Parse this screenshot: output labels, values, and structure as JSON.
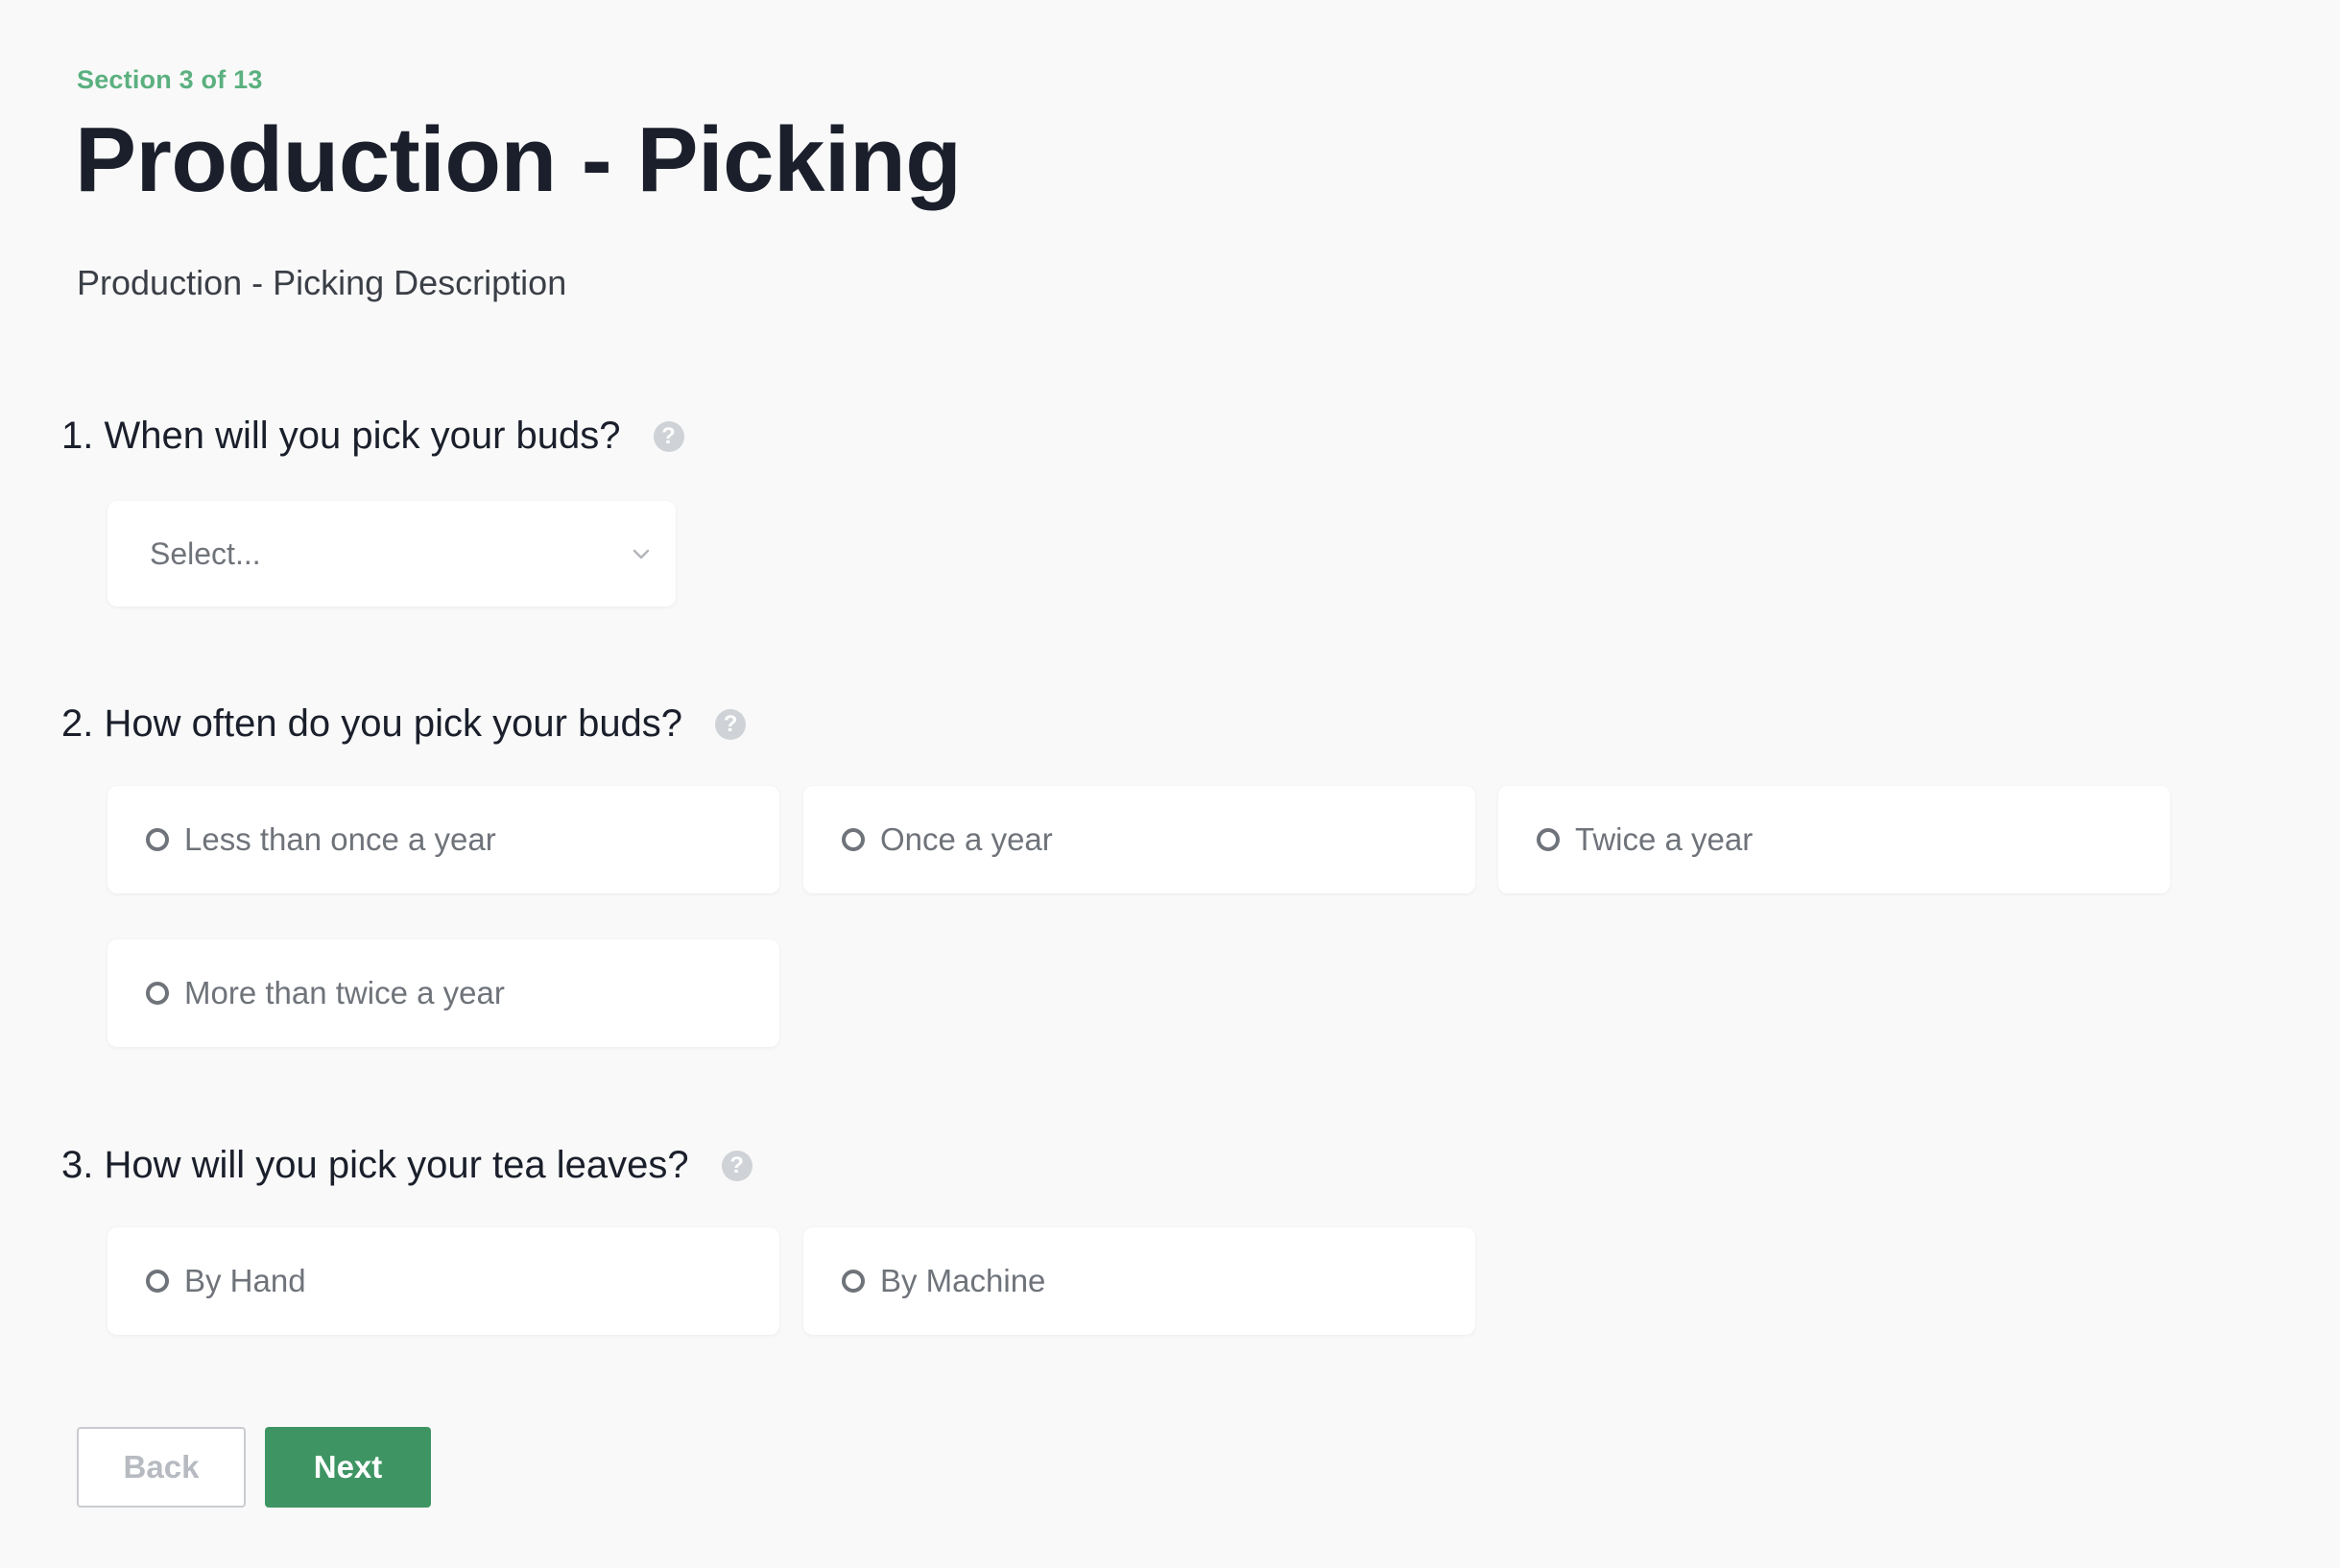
{
  "section": {
    "label": "Section 3 of 13",
    "title": "Production - Picking",
    "description": "Production - Picking Description"
  },
  "questions": [
    {
      "label": "1. When will you pick your buds?",
      "help_icon": "question-circle-icon",
      "type": "select",
      "placeholder": "Select..."
    },
    {
      "label": "2. How often do you pick your buds?",
      "help_icon": "question-circle-icon",
      "type": "radio",
      "options": [
        "Less than once a year",
        "Once a year",
        "Twice a year",
        "More than twice a year"
      ]
    },
    {
      "label": "3. How will you pick your tea leaves?",
      "help_icon": "question-circle-icon",
      "type": "radio",
      "options": [
        "By Hand",
        "By Machine"
      ]
    }
  ],
  "nav": {
    "back_label": "Back",
    "next_label": "Next"
  },
  "colors": {
    "accent": "#3e9563",
    "section_label": "#5bb07f",
    "background": "#f9f9f9"
  }
}
